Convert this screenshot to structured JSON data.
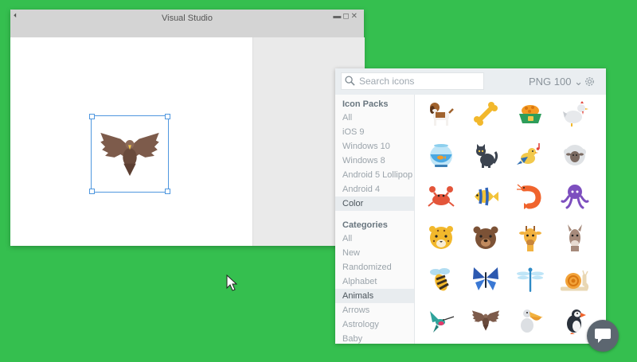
{
  "window": {
    "title": "Visual Studio",
    "logo_glyph": "⏴",
    "controls": "▬◻✕"
  },
  "panel": {
    "search": {
      "placeholder": "Search icons",
      "value": ""
    },
    "format": "PNG 100",
    "format_caret": "⌄",
    "icon_packs": {
      "heading": "Icon Packs",
      "items": [
        "All",
        "iOS 9",
        "Windows 10",
        "Windows 8",
        "Android 5 Lollipop",
        "Android 4",
        "Color"
      ],
      "selected": "Color"
    },
    "categories": {
      "heading": "Categories",
      "items": [
        "All",
        "New",
        "Randomized",
        "Alphabet",
        "Animals",
        "Arrows",
        "Astrology",
        "Baby"
      ],
      "selected": "Animals"
    },
    "icons": [
      "beagle-icon",
      "bone-icon",
      "dog-bowl-icon",
      "chicken-icon",
      "aquarium-icon",
      "cat-icon",
      "singing-bird-icon",
      "sheep-icon",
      "crab-icon",
      "tropical-fish-icon",
      "shrimp-icon",
      "octopus-icon",
      "leopard-icon",
      "bear-icon",
      "giraffe-icon",
      "llama-icon",
      "bee-icon",
      "butterfly-icon",
      "dragonfly-icon",
      "snail-icon",
      "hummingbird-icon",
      "eagle-icon",
      "pelican-icon",
      "puffin-icon"
    ]
  },
  "colors": {
    "background": "#35bf4f",
    "selection": "#4f97df",
    "chat_button": "#5c6670"
  }
}
